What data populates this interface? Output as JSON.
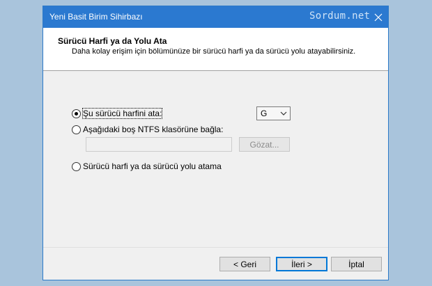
{
  "window": {
    "title": "Yeni Basit Birim Sihirbazı",
    "watermark": "Sordum.net",
    "accent_color": "#2b79d0"
  },
  "header": {
    "title": "Sürücü Harfi ya da Yolu Ata",
    "subtitle": "Daha kolay erişim için bölümünüze bir sürücü harfi ya da sürücü yolu atayabilirsiniz."
  },
  "options": {
    "assign_letter": {
      "label": "Şu sürücü harfini ata:",
      "checked": true
    },
    "mount_folder": {
      "label": "Aşağıdaki boş NTFS klasörüne bağla:",
      "checked": false
    },
    "no_letter": {
      "label": "Sürücü harfi ya da sürücü yolu atama",
      "checked": false
    }
  },
  "drive_letter_select": {
    "value": "G"
  },
  "folder_path_input": {
    "value": ""
  },
  "browse_button": {
    "label": "Gözat...",
    "enabled": false
  },
  "footer": {
    "back_label": "< Geri",
    "next_label": "İleri >",
    "cancel_label": "İptal"
  }
}
